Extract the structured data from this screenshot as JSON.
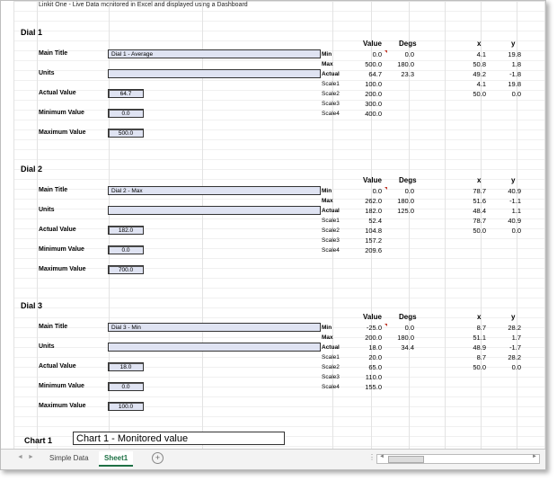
{
  "header_note": "Linkit One - Live Data monitored in Excel and displayed using a Dashboard",
  "field_labels": {
    "main_title": "Main Title",
    "units": "Units",
    "actual": "Actual Value",
    "minimum": "Minimum Value",
    "maximum": "Maximum Value"
  },
  "col_headers": {
    "value": "Value",
    "degs": "Degs",
    "x": "x",
    "y": "y"
  },
  "row_labels": [
    "Min",
    "Max",
    "Actual",
    "Scale1",
    "Scale2",
    "Scale3",
    "Scale4"
  ],
  "dials": [
    {
      "title": "Dial 1",
      "main_title": "Dial 1 - Average",
      "units": "",
      "actual": "64.7",
      "minimum": "0.0",
      "maximum": "500.0",
      "values": [
        "0.0",
        "500.0",
        "64.7",
        "100.0",
        "200.0",
        "300.0",
        "400.0"
      ],
      "degs": [
        "0.0",
        "180.0",
        "23.3"
      ],
      "x": [
        "4.1",
        "50.8",
        "49.2",
        "4.1",
        "50.0"
      ],
      "y": [
        "19.8",
        "1.8",
        "-1.8",
        "19.8",
        "0.0"
      ]
    },
    {
      "title": "Dial 2",
      "main_title": "Dial 2 - Max",
      "units": "",
      "actual": "182.0",
      "minimum": "0.0",
      "maximum": "700.0",
      "values": [
        "0.0",
        "262.0",
        "182.0",
        "52.4",
        "104.8",
        "157.2",
        "209.6"
      ],
      "degs": [
        "0.0",
        "180.0",
        "125.0"
      ],
      "x": [
        "78.7",
        "51.6",
        "48.4",
        "78.7",
        "50.0"
      ],
      "y": [
        "40.9",
        "-1.1",
        "1.1",
        "40.9",
        "0.0"
      ]
    },
    {
      "title": "Dial 3",
      "main_title": "Dial 3 - Min",
      "units": "",
      "actual": "18.0",
      "minimum": "0.0",
      "maximum": "100.0",
      "values": [
        "-25.0",
        "200.0",
        "18.0",
        "20.0",
        "65.0",
        "110.0",
        "155.0"
      ],
      "degs": [
        "0.0",
        "180.0",
        "34.4"
      ],
      "x": [
        "8.7",
        "51.1",
        "48.9",
        "8.7",
        "50.0"
      ],
      "y": [
        "28.2",
        "1.7",
        "-1.7",
        "28.2",
        "0.0"
      ]
    }
  ],
  "chart1": {
    "label": "Chart 1",
    "title": "Chart 1 - Monitored value"
  },
  "tabs": [
    "Simple Data",
    "Sheet1"
  ],
  "active_tab": "Sheet1",
  "add_sheet_symbol": "+",
  "nav_prev": "◄",
  "nav_next": "►",
  "ellipsis": "⋮"
}
